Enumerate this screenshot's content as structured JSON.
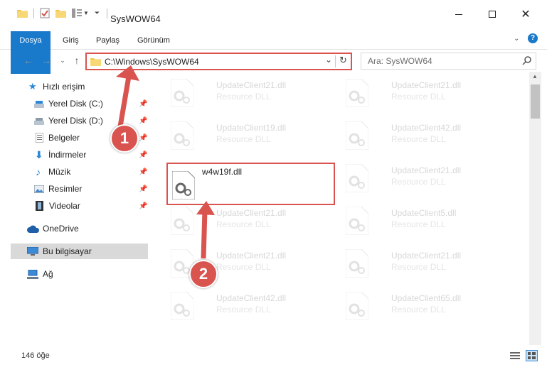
{
  "window": {
    "title": "SysWOW64"
  },
  "ribbon": {
    "tabs": [
      "Dosya",
      "Giriş",
      "Paylaş",
      "Görünüm"
    ]
  },
  "address": {
    "path": "C:\\Windows\\SysWOW64"
  },
  "search": {
    "placeholder": "Ara: SysWOW64"
  },
  "nav": {
    "items": [
      {
        "label": "Hızlı erişim"
      },
      {
        "label": "Yerel Disk (C:)"
      },
      {
        "label": "Yerel Disk (D:)"
      },
      {
        "label": "Belgeler"
      },
      {
        "label": "İndirmeler"
      },
      {
        "label": "Müzik"
      },
      {
        "label": "Resimler"
      },
      {
        "label": "Videolar"
      },
      {
        "label": "OneDrive"
      },
      {
        "label": "Bu bilgisayar"
      },
      {
        "label": "Ağ"
      }
    ]
  },
  "files": [
    {
      "name": "UpdateClient21.dll",
      "type": "Resource DLL"
    },
    {
      "name": "UpdateClient21.dll",
      "type": "Resource DLL"
    },
    {
      "name": "UpdateClient19.dll",
      "type": "Resource DLL"
    },
    {
      "name": "UpdateClient42.dll",
      "type": "Resource DLL"
    },
    {
      "name": "w4w19f.dll",
      "type": ""
    },
    {
      "name": "UpdateClient21.dll",
      "type": "Resource DLL"
    },
    {
      "name": "UpdateClient21.dll",
      "type": "Resource DLL"
    },
    {
      "name": "UpdateClient5.dll",
      "type": "Resource DLL"
    },
    {
      "name": "UpdateClient21.dll",
      "type": "Resource DLL"
    },
    {
      "name": "UpdateClient21.dll",
      "type": "Resource DLL"
    },
    {
      "name": "UpdateClient42.dll",
      "type": "Resource DLL"
    },
    {
      "name": "UpdateClient65.dll",
      "type": "Resource DLL"
    }
  ],
  "status": {
    "count": "146 öğe"
  },
  "callouts": [
    "1",
    "2"
  ],
  "colors": {
    "accent": "#1979ca",
    "highlight": "#d9534f",
    "folder": "#f5c64b"
  }
}
